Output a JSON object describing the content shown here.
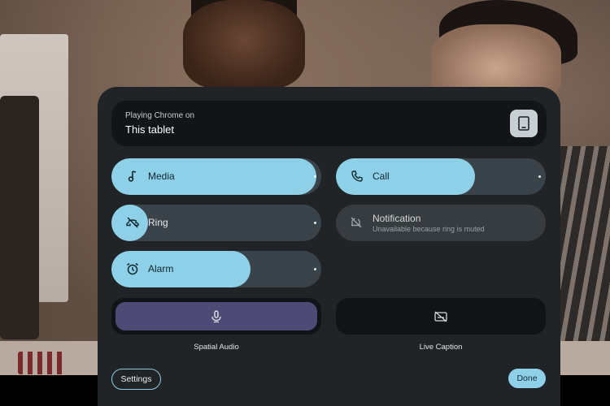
{
  "output": {
    "playing_label": "Playing Chrome on",
    "device_name": "This tablet",
    "device_icon": "tablet-icon"
  },
  "volume": {
    "media": {
      "label": "Media",
      "icon": "music-note-icon",
      "level": 0.97
    },
    "call": {
      "label": "Call",
      "icon": "phone-icon",
      "level": 0.59
    },
    "ring": {
      "label": "Ring",
      "icon": "ring-muted-icon",
      "level": 0.0,
      "muted": true
    },
    "notification": {
      "label": "Notification",
      "status": "Unavailable because ring is muted",
      "icon": "notification-muted-icon"
    },
    "alarm": {
      "label": "Alarm",
      "icon": "alarm-icon",
      "level": 0.59
    }
  },
  "toggles": {
    "spatial_audio": {
      "label": "Spatial Audio",
      "icon": "spatial-audio-icon",
      "active": true
    },
    "live_caption": {
      "label": "Live Caption",
      "icon": "live-caption-off-icon",
      "active": false
    }
  },
  "footer": {
    "settings_label": "Settings",
    "done_label": "Done"
  },
  "colors": {
    "accent": "#8ed0e7",
    "panel": "#202427",
    "track": "#394349",
    "spatial_active": "#4d4b76"
  }
}
